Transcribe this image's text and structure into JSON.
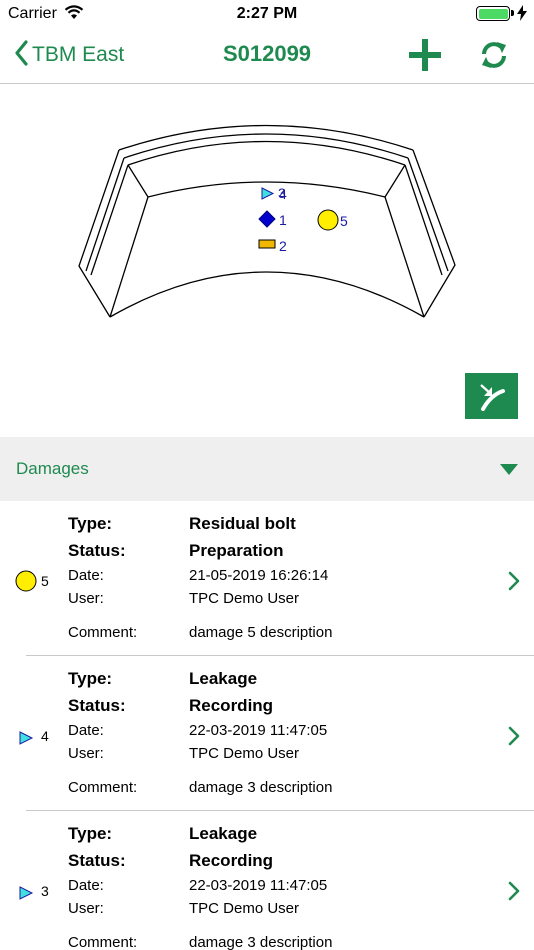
{
  "status_bar": {
    "carrier": "Carrier",
    "time": "2:27 PM"
  },
  "nav": {
    "back_label": "TBM East",
    "title": "S012099"
  },
  "diagram": {
    "markers": [
      {
        "num": "3",
        "shape": "triangle",
        "color": "#40e0e0"
      },
      {
        "num": "4",
        "shape": "triangle",
        "color": "#40e0e0"
      },
      {
        "num": "1",
        "shape": "diamond",
        "color": "#0000cc"
      },
      {
        "num": "2",
        "shape": "rect",
        "color": "#f0b800"
      },
      {
        "num": "5",
        "shape": "circle",
        "color": "#ffee00"
      }
    ]
  },
  "section": {
    "title": "Damages"
  },
  "labels": {
    "type": "Type:",
    "status": "Status:",
    "date": "Date:",
    "user": "User:",
    "comment": "Comment:"
  },
  "damages": [
    {
      "num": "5",
      "marker": "circle",
      "type": "Residual bolt",
      "status": "Preparation",
      "date": "21-05-2019 16:26:14",
      "user": "TPC Demo User",
      "comment": "damage 5 description"
    },
    {
      "num": "4",
      "marker": "triangle",
      "type": "Leakage",
      "status": "Recording",
      "date": "22-03-2019 11:47:05",
      "user": "TPC Demo User",
      "comment": "damage 3 description"
    },
    {
      "num": "3",
      "marker": "triangle",
      "type": "Leakage",
      "status": "Recording",
      "date": "22-03-2019 11:47:05",
      "user": "TPC Demo User",
      "comment": "damage 3 description"
    }
  ]
}
